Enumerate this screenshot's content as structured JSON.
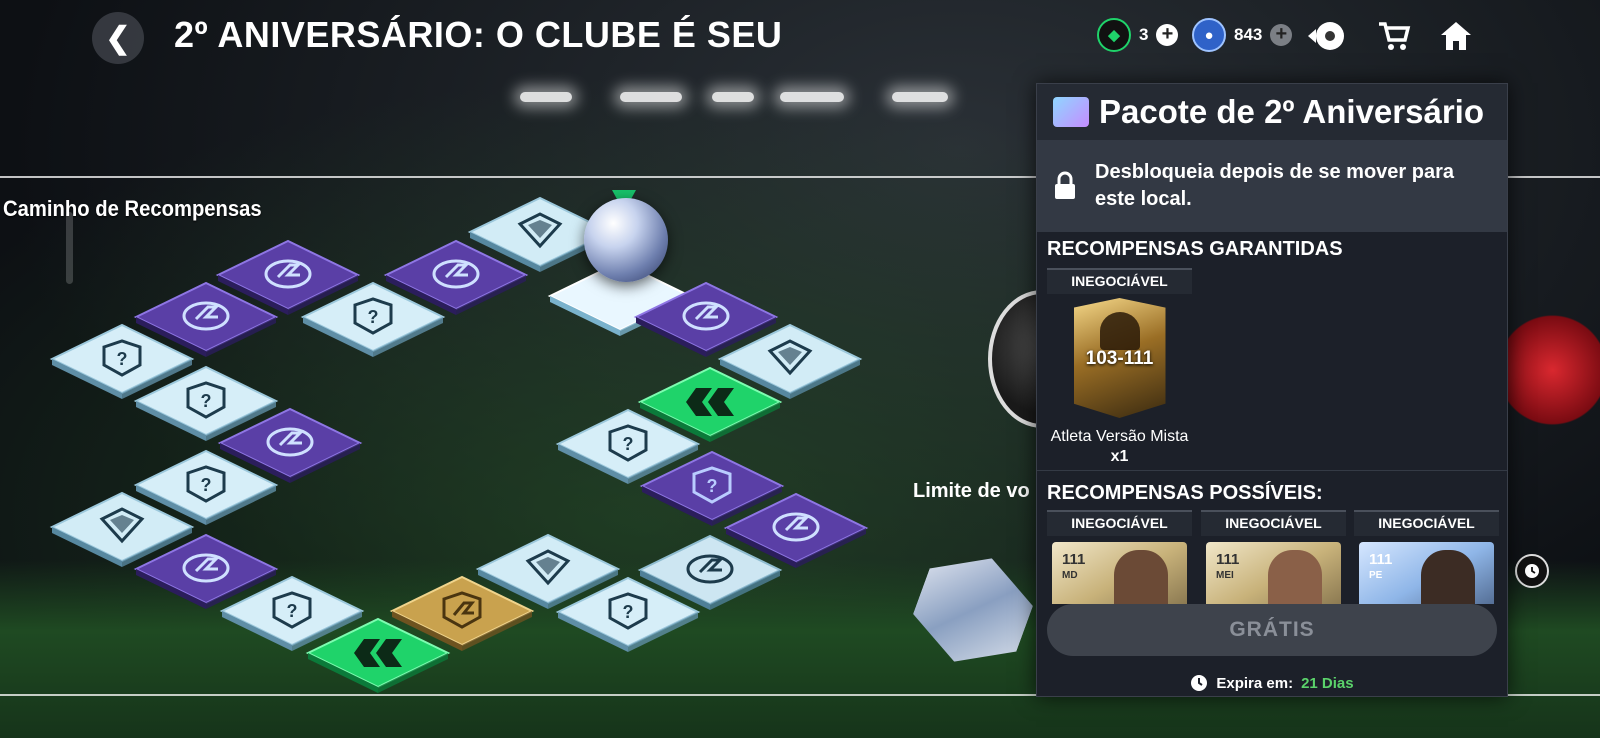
{
  "header": {
    "back_icon": "chevron-left-icon",
    "title": "2º ANIVERSÁRIO: O CLUBE É SEU"
  },
  "hud": {
    "token_count": "3",
    "coin_count": "843",
    "icons": [
      "fc-token-icon",
      "plus-icon",
      "football-coin-icon",
      "plus-icon",
      "ball-pack-icon",
      "cart-icon",
      "home-icon"
    ]
  },
  "board": {
    "label": "Caminho de Recompensas",
    "tile_types": [
      "question",
      "fc-logo",
      "gem",
      "boost",
      "question-purple",
      "gold"
    ]
  },
  "background": {
    "limit_text": "Limite de vo"
  },
  "panel": {
    "title": "Pacote de 2º Aniversário",
    "lock_text": "Desbloqueia depois de se mover para este local.",
    "guaranteed_title": "RECOMPENSAS GARANTIDAS",
    "guaranteed_item": {
      "tag": "INEGOCIÁVEL",
      "rating": "103-111",
      "name": "Atleta Versão Mista",
      "qty": "x1"
    },
    "possible_title": "RECOMPENSAS POSSÍVEIS:",
    "possible_items": [
      {
        "tag": "INEGOCIÁVEL",
        "rating": "111",
        "position": "MD"
      },
      {
        "tag": "INEGOCIÁVEL",
        "rating": "111",
        "position": "MEI"
      },
      {
        "tag": "INEGOCIÁVEL",
        "rating": "111",
        "position": "PE"
      }
    ],
    "button_label": "GRÁTIS",
    "expiry_label": "Expira em:",
    "expiry_value": "21 Dias"
  },
  "colors": {
    "panel_bg": "#1c2029",
    "expiry_green": "#5bd36b",
    "tile_light": "#cde6f2",
    "tile_purple": "#5a3fa6",
    "tile_green": "#1fd36a",
    "tile_gold": "#c9a24e"
  }
}
